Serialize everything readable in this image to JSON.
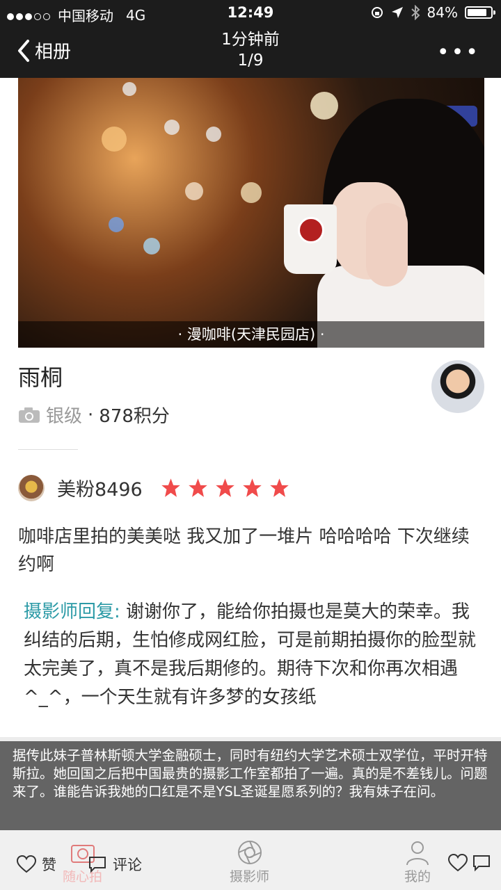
{
  "status_bar": {
    "carrier": "中国移动",
    "network": "4G",
    "time": "12:49",
    "battery": "84%",
    "battery_level": 0.84
  },
  "nav": {
    "back_label": "相册",
    "title": "1分钟前",
    "counter": "1/9",
    "more_icon": "more-dots-icon"
  },
  "photo": {
    "caption": "· 漫咖啡(天津民园店) ·"
  },
  "author": {
    "name": "雨桐",
    "level": "银级",
    "separator": "·",
    "points": "878积分"
  },
  "review": {
    "username": "美粉8496",
    "rating": 5,
    "text": "咖啡店里拍的美美哒 我又加了一堆片 哈哈哈哈 下次继续约啊",
    "reply_label": "摄影师回复:",
    "reply_text": " 谢谢你了，能给你拍摄也是莫大的荣幸。我纠结的后期，生怕修成网红脸，可是前期拍摄你的脸型就太完美了，真不是我后期修的。期待下次和你再次相遇^_^，一个天生就有许多梦的女孩纸",
    "star_color": "#f04b4b"
  },
  "overlay": {
    "text": "据传此妹子普林斯顿大学金融硕士，同时有纽约大学艺术硕士双学位，平时开特斯拉。她回国之后把中国最贵的摄影工作室都拍了一遍。真的是不差钱儿。问题来了。谁能告诉我她的口红是不是YSL圣诞星愿系列的？我有妹子在问。"
  },
  "tabs": [
    {
      "label": "随心拍",
      "icon": "camera-icon"
    },
    {
      "label": "摄影师",
      "icon": "aperture-icon"
    },
    {
      "label": "我的",
      "icon": "person-icon"
    }
  ],
  "actions": {
    "like_label": "赞",
    "comment_label": "评论"
  }
}
